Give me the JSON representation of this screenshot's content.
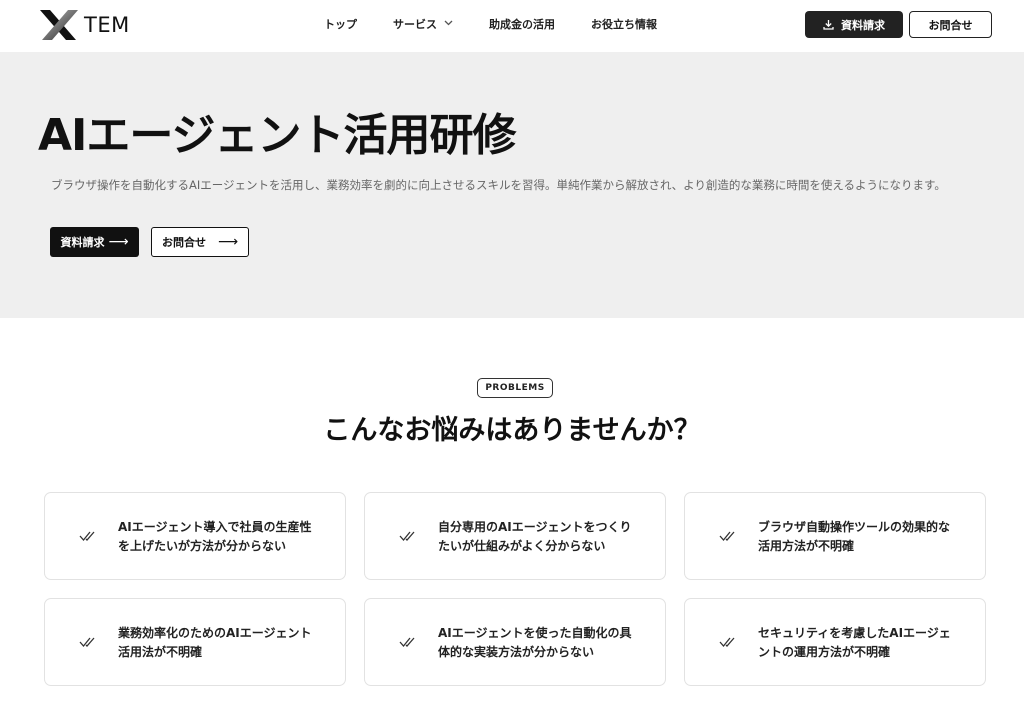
{
  "header": {
    "logo_text": "TEM",
    "nav": [
      {
        "label": "トップ"
      },
      {
        "label": "サービス"
      },
      {
        "label": "助成金の活用"
      },
      {
        "label": "お役立ち情報"
      }
    ],
    "download_button": "資料請求",
    "contact_button": "お問合せ"
  },
  "hero": {
    "title": "AIエージェント活用研修",
    "description": "ブラウザ操作を自動化するAIエージェントを活用し、業務効率を劇的に向上させるスキルを習得。単純作業から解放され、より創造的な業務に時間を使えるようになります。",
    "doc_button": "資料請求",
    "contact_button": "お問合せ",
    "arrow": "⟶"
  },
  "problems": {
    "badge": "PROBLEMS",
    "title": "こんなお悩みはありませんか？",
    "cards": [
      {
        "line1": "AIエージェント導入で社員の生産性",
        "line2": "を上げたいが方法が分からない"
      },
      {
        "line1": "自分専用のAIエージェントをつくり",
        "line2": "たいが仕組みがよく分からない"
      },
      {
        "line1": "ブラウザ自動操作ツールの効果的な",
        "line2": "活用方法が不明確"
      },
      {
        "line1": "業務効率化のためのAIエージェント",
        "line2": "活用法が不明確"
      },
      {
        "line1": "AIエージェントを使った自動化の具",
        "line2": "体的な実装方法が分からない"
      },
      {
        "line1": "セキュリティを考慮したAIエージェ",
        "line2": "ントの運用方法が不明確"
      }
    ]
  },
  "colors": {
    "hero_bg": "#efefef",
    "primary_button": "#111111",
    "text": "#111111",
    "muted_text": "#666666"
  },
  "icons": {
    "download": "download-icon",
    "check": "double-check-icon",
    "chevron": "chevron-down-icon"
  }
}
